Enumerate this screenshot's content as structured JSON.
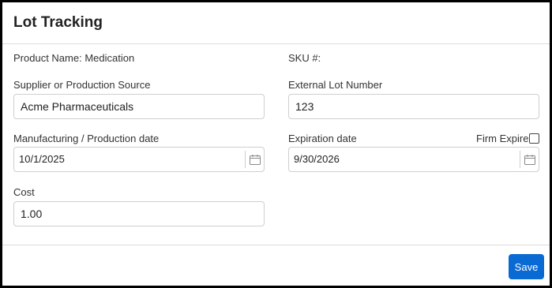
{
  "dialog": {
    "title": "Lot Tracking"
  },
  "product": {
    "name_label": "Product Name: Medication",
    "sku_label": "SKU #:"
  },
  "fields": {
    "supplier": {
      "label": "Supplier or Production Source",
      "value": "Acme Pharmaceuticals"
    },
    "external_lot": {
      "label": "External Lot Number",
      "value": "123"
    },
    "manufacturing_date": {
      "label": "Manufacturing / Production date",
      "value": "10/1/2025"
    },
    "expiration_date": {
      "label": "Expiration date",
      "value": "9/30/2026"
    },
    "firm_expire": {
      "label": "Firm Expire",
      "checked": false
    },
    "cost": {
      "label": "Cost",
      "value": "1.00"
    }
  },
  "footer": {
    "save_label": "Save"
  },
  "colors": {
    "primary_button": "#0a6ad4",
    "border": "#cfcfcf"
  },
  "icons": {
    "calendar": "calendar-icon"
  }
}
